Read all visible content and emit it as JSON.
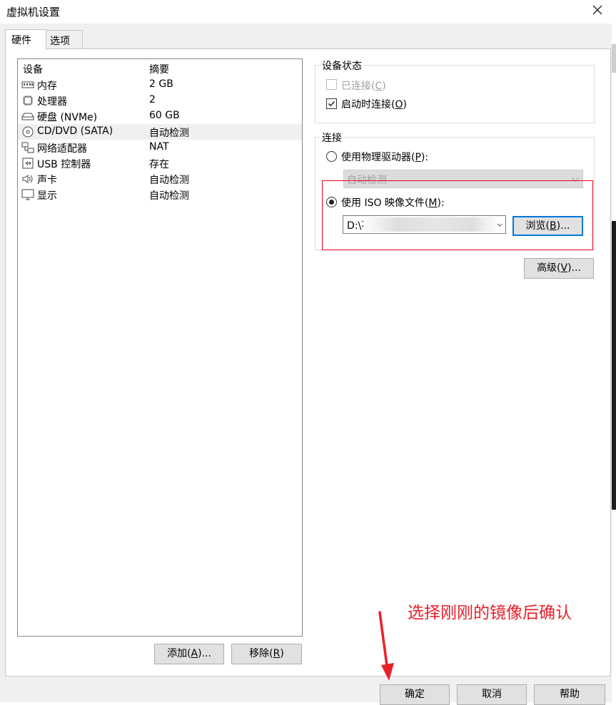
{
  "window": {
    "title": "虚拟机设置",
    "close_symbol": "✕"
  },
  "tabs": [
    {
      "label": "硬件"
    },
    {
      "label": "选项"
    }
  ],
  "device_list": {
    "col_device": "设备",
    "col_summary": "摘要",
    "rows": [
      {
        "icon": "memory-icon",
        "name": "内存",
        "summary": "2 GB"
      },
      {
        "icon": "cpu-icon",
        "name": "处理器",
        "summary": "2"
      },
      {
        "icon": "disk-icon",
        "name": "硬盘 (NVMe)",
        "summary": "60 GB"
      },
      {
        "icon": "cd-dvd-icon",
        "name": "CD/DVD (SATA)",
        "summary": "自动检测"
      },
      {
        "icon": "network-icon",
        "name": "网络适配器",
        "summary": "NAT"
      },
      {
        "icon": "usb-icon",
        "name": "USB 控制器",
        "summary": "存在"
      },
      {
        "icon": "speaker-icon",
        "name": "声卡",
        "summary": "自动检测"
      },
      {
        "icon": "monitor-icon",
        "name": "显示",
        "summary": "自动检测"
      }
    ],
    "selected_index": 3
  },
  "list_buttons": {
    "add": {
      "text": "添加(",
      "key": "A",
      "tail": ")..."
    },
    "remove": {
      "text": "移除(",
      "key": "R",
      "tail": ")"
    }
  },
  "device_status": {
    "title": "设备状态",
    "connected": {
      "text": "已连接(",
      "key": "C",
      "tail": ")",
      "checked": false,
      "enabled": false
    },
    "connect_at_power_on": {
      "text": "启动时连接(",
      "key": "O",
      "tail": ")",
      "checked": true,
      "enabled": true
    }
  },
  "connection": {
    "title": "连接",
    "physical_drive": {
      "text": "使用物理驱动器(",
      "key": "P",
      "tail": "):",
      "selected": false
    },
    "drive_combo_value": "自动检测",
    "iso": {
      "text": "使用 ISO 映像文件(",
      "key": "M",
      "tail": "):",
      "selected": true
    },
    "iso_path_visible": "D:\\不",
    "browse": {
      "text": "浏览(",
      "key": "B",
      "tail": ")..."
    }
  },
  "advanced_button": {
    "text": "高级(",
    "key": "V",
    "tail": ")..."
  },
  "footer": {
    "ok": "确定",
    "cancel": "取消",
    "help": "帮助"
  },
  "annotation": {
    "text": "选择刚刚的镜像后确认",
    "color": "#e8202a"
  }
}
